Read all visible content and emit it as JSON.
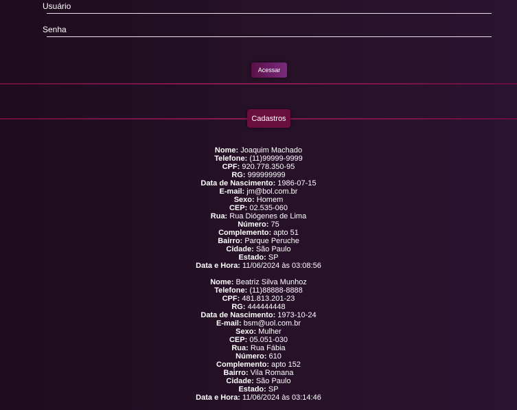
{
  "login": {
    "user_label": "Usuário",
    "password_label": "Senha",
    "submit_label": "Acessar"
  },
  "cadastros_label": "Cadastros",
  "records": [
    {
      "nome": "Joaquim Machado",
      "telefone": "(11)99999-9999",
      "cpf": "920.778.350-95",
      "rg": "999999999",
      "nascimento": "1986-07-15",
      "email": "jm@bol.com.br",
      "sexo": "Homem",
      "cep": "02.535-060",
      "rua": "Rua Diógenes de Lima",
      "numero": "75",
      "complemento": "apto 51",
      "bairro": "Parque Peruche",
      "cidade": "São Paulo",
      "estado": "SP",
      "datahora": "11/06/2024 às 03:08:56"
    },
    {
      "nome": "Beatriz Silva Munhoz",
      "telefone": "(11)88888-8888",
      "cpf": "481.813.201-23",
      "rg": "444444448",
      "nascimento": "1973-10-24",
      "email": "bsm@uol.com.br",
      "sexo": "Mulher",
      "cep": "05.051-030",
      "rua": "Rua Fábia",
      "numero": "610",
      "complemento": "apto 152",
      "bairro": "Vila Romana",
      "cidade": "São Paulo",
      "estado": "SP",
      "datahora": "11/06/2024 às 03:14:46"
    }
  ],
  "field_labels": {
    "nome": "Nome:",
    "telefone": "Telefone:",
    "cpf": "CPF:",
    "rg": "RG:",
    "nascimento": "Data de Nascimento:",
    "email": "E-mail:",
    "sexo": "Sexo:",
    "cep": "CEP:",
    "rua": "Rua:",
    "numero": "Número:",
    "complemento": "Complemento:",
    "bairro": "Bairro:",
    "cidade": "Cidade:",
    "estado": "Estado:",
    "datahora": "Data e Hora:"
  }
}
